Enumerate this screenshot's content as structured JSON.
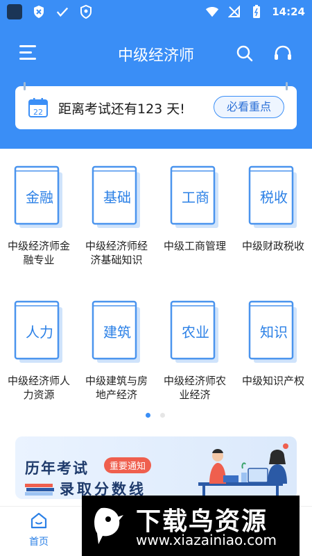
{
  "status_bar": {
    "time": "14:24"
  },
  "nav": {
    "title": "中级经济师"
  },
  "countdown": {
    "text": "距离考试还有123 天!",
    "calendar_day": "22",
    "button_label": "必看重点"
  },
  "subjects": [
    {
      "book_label": "金融",
      "title": "中级经济师金融专业"
    },
    {
      "book_label": "基础",
      "title": "中级经济师经济基础知识"
    },
    {
      "book_label": "工商",
      "title": "中级工商管理"
    },
    {
      "book_label": "税收",
      "title": "中级财政税收"
    },
    {
      "book_label": "人力",
      "title": "中级经济师人力资源"
    },
    {
      "book_label": "建筑",
      "title": "中级建筑与房地产经济"
    },
    {
      "book_label": "农业",
      "title": "中级经济师农业经济"
    },
    {
      "book_label": "知识",
      "title": "中级知识产权"
    }
  ],
  "banner": {
    "line1": "历年考试",
    "badge": "重要通知",
    "line2": "录取分数线"
  },
  "tabbar": {
    "home_label": "首页"
  },
  "watermark": {
    "title": "下载鸟资源",
    "url": "www.xiazainiao.com"
  },
  "colors": {
    "primary": "#3a8ef6",
    "book_text": "#2b80e6",
    "badge": "#ef5f4e"
  }
}
